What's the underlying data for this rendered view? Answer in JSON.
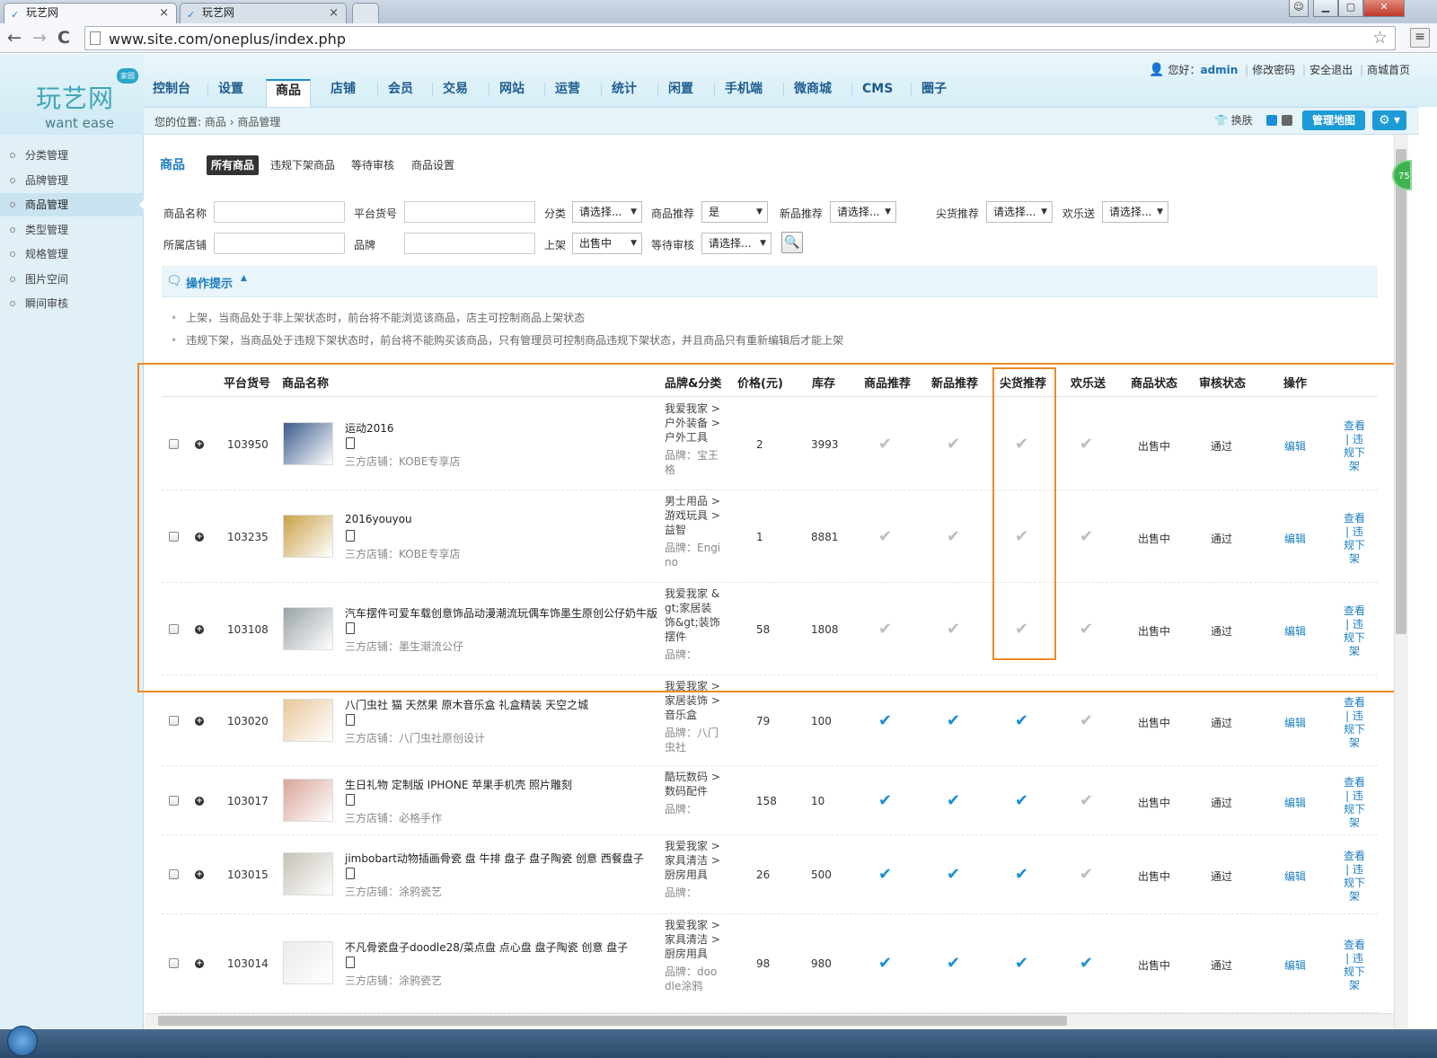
{
  "browser": {
    "tabs": [
      {
        "title": "玩艺网",
        "active": true
      },
      {
        "title": "玩艺网",
        "active": false
      }
    ],
    "url": "www.site.com/oneplus/index.php",
    "back_icon": "←",
    "forward_icon": "→",
    "reload_icon": "C",
    "star_icon": "☆",
    "menu_icon": "≡"
  },
  "app": {
    "logo": {
      "brand": "玩艺网",
      "slogan": "want ease",
      "bubble": "家园"
    },
    "main_nav": [
      "控制台",
      "设置",
      "商品",
      "店铺",
      "会员",
      "交易",
      "网站",
      "运营",
      "统计",
      "闲置",
      "手机端",
      "微商城",
      "CMS",
      "圈子"
    ],
    "main_nav_active": "商品",
    "user_bar": {
      "greeting": "您好：",
      "username": "admin",
      "change_password": "修改密码",
      "logout": "安全退出",
      "mall_home": "商城首页"
    },
    "breadcrumb": {
      "prefix": "您的位置:",
      "level1": "商品",
      "sep": "›",
      "level2": "商品管理"
    },
    "skin_label": "换肤",
    "skin_colors": [
      "#1a8fd6",
      "#666666"
    ],
    "manage_map": "管理地图",
    "gear_icon": "⚙"
  },
  "sidebar": {
    "items": [
      "分类管理",
      "品牌管理",
      "商品管理",
      "类型管理",
      "规格管理",
      "图片空间",
      "瞬间审核"
    ],
    "active_index": 2
  },
  "subtabs": {
    "title": "商品",
    "all": "所有商品",
    "violation": "违规下架商品",
    "pending": "等待审核",
    "settings": "商品设置"
  },
  "filters": {
    "product_name": "商品名称",
    "platform_sku": "平台货号",
    "category": {
      "label": "分类",
      "value": "请选择..."
    },
    "recommend": {
      "label": "商品推荐",
      "value": "是"
    },
    "new_recommend": {
      "label": "新品推荐",
      "value": "请选择..."
    },
    "hot_recommend": {
      "label": "尖货推荐",
      "value": "请选择..."
    },
    "happy_send": {
      "label": "欢乐送",
      "value": "请选择..."
    },
    "store": "所属店铺",
    "brand": "品牌",
    "listing": {
      "label": "上架",
      "value": "出售中"
    },
    "audit": {
      "label": "等待审核",
      "value": "请选择..."
    },
    "search_icon": "search-icon"
  },
  "tips": {
    "title": "操作提示",
    "lines": [
      "上架，当商品处于非上架状态时，前台将不能浏览该商品，店主可控制商品上架状态",
      "违规下架，当商品处于违规下架状态时，前台将不能购买该商品，只有管理员可控制商品违规下架状态，并且商品只有重新编辑后才能上架"
    ]
  },
  "table": {
    "headers": {
      "sku": "平台货号",
      "name": "商品名称",
      "brand_cat": "品牌&分类",
      "price": "价格(元)",
      "stock": "库存",
      "recommend": "商品推荐",
      "new": "新品推荐",
      "hot": "尖货推荐",
      "happy": "欢乐送",
      "status": "商品状态",
      "audit": "审核状态",
      "op": "操作"
    },
    "store_prefix": "三方店铺：",
    "op_edit": "编辑",
    "op_more": "查看 | 违规下架",
    "rows": [
      {
        "sku": "103950",
        "name": "运动2016",
        "store": "KOBE专享店",
        "category": "我爱我家 > 户外装备 > 户外工具",
        "brand": "品牌：宝王格",
        "price": "2",
        "stock": "3993",
        "rec": false,
        "new": false,
        "hot": false,
        "happy": false,
        "status": "出售中",
        "audit": "通过"
      },
      {
        "sku": "103235",
        "name": "2016youyou",
        "store": "KOBE专享店",
        "category": "男士用品 > 游戏玩具 > 益智",
        "brand": "品牌：Engino",
        "price": "1",
        "stock": "8881",
        "rec": false,
        "new": false,
        "hot": false,
        "happy": false,
        "status": "出售中",
        "audit": "通过"
      },
      {
        "sku": "103108",
        "name": "汽车摆件可爱车载创意饰品动漫潮流玩偶车饰墨生原创公仔奶牛版",
        "store": "墨生潮流公仔",
        "category": "我爱我家 &gt;家居装饰&gt;装饰摆件",
        "brand": "品牌：",
        "price": "58",
        "stock": "1808",
        "rec": false,
        "new": false,
        "hot": false,
        "happy": false,
        "status": "出售中",
        "audit": "通过"
      },
      {
        "sku": "103020",
        "name": "八门虫社 猫 天然果 原木音乐盒 礼盒精装 天空之城",
        "store": "八门虫社原创设计",
        "category": "我爱我家 > 家居装饰 > 音乐盒",
        "brand": "品牌：八门虫社",
        "price": "79",
        "stock": "100",
        "rec": true,
        "new": true,
        "hot": true,
        "happy": false,
        "status": "出售中",
        "audit": "通过"
      },
      {
        "sku": "103017",
        "name": "生日礼物 定制版 IPHONE 苹果手机壳 照片雕刻",
        "store": "必格手作",
        "category": "酷玩数码 > 数码配件",
        "brand": "品牌：",
        "price": "158",
        "stock": "10",
        "rec": true,
        "new": true,
        "hot": true,
        "happy": false,
        "status": "出售中",
        "audit": "通过"
      },
      {
        "sku": "103015",
        "name": "jimbobart动物插画骨瓷 盘 牛排 盘子 盘子陶瓷 创意 西餐盘子",
        "store": "涂鸦瓷艺",
        "category": "我爱我家 > 家具清洁 > 厨房用具",
        "brand": "品牌：",
        "price": "26",
        "stock": "500",
        "rec": true,
        "new": true,
        "hot": true,
        "happy": false,
        "status": "出售中",
        "audit": "通过"
      },
      {
        "sku": "103014",
        "name": "不凡骨瓷盘子doodle28/菜点盘 点心盘 盘子陶瓷 创意 盘子",
        "store": "涂鸦瓷艺",
        "category": "我爱我家 > 家具清洁 > 厨房用具",
        "brand": "品牌：doodle涂鸦",
        "price": "98",
        "stock": "980",
        "rec": true,
        "new": true,
        "hot": true,
        "happy": true,
        "status": "出售中",
        "audit": "通过"
      }
    ]
  },
  "side_badge": "75",
  "check_glyph": "✔"
}
